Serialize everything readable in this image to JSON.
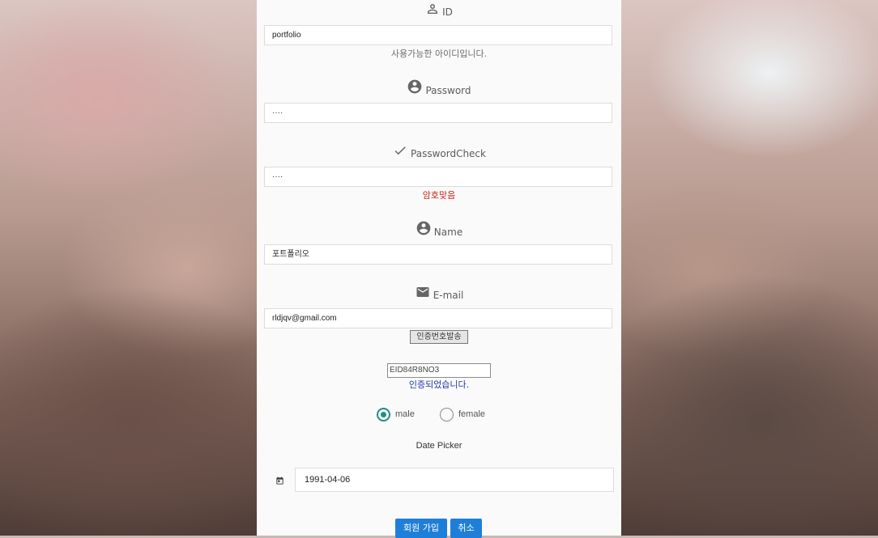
{
  "colors": {
    "accent": "#1e8f84",
    "button": "#1f7fd8",
    "error": "#c0281e",
    "ok": "#1e3aa0"
  },
  "form": {
    "id_label": "ID",
    "id_value": "portfolio",
    "id_message": "사용가능한 아이디입니다.",
    "password_label": "Password",
    "password_value": "····",
    "password_check_label": "PasswordCheck",
    "password_check_value": "····",
    "password_check_message": "암호맞음",
    "name_label": "Name",
    "name_value": "포트폴리오",
    "email_label": "E-mail",
    "email_value": "rldjqv@gmail.com",
    "send_code_button": "인증번호발송",
    "code_value": "EID84R8NO3",
    "code_message": "인증되었습니다.",
    "gender_options": [
      {
        "label": "male",
        "selected": true
      },
      {
        "label": "female",
        "selected": false
      }
    ],
    "date_picker_label": "Date Picker",
    "date_value": "1991-04-06",
    "signup_button": "회원 가입",
    "cancel_button": "취소"
  },
  "icons": {
    "id": "person-outline-icon",
    "password": "account-circle-icon",
    "password_check": "check-icon",
    "name": "account-circle-icon",
    "email": "mail-icon",
    "date": "calendar-icon"
  }
}
